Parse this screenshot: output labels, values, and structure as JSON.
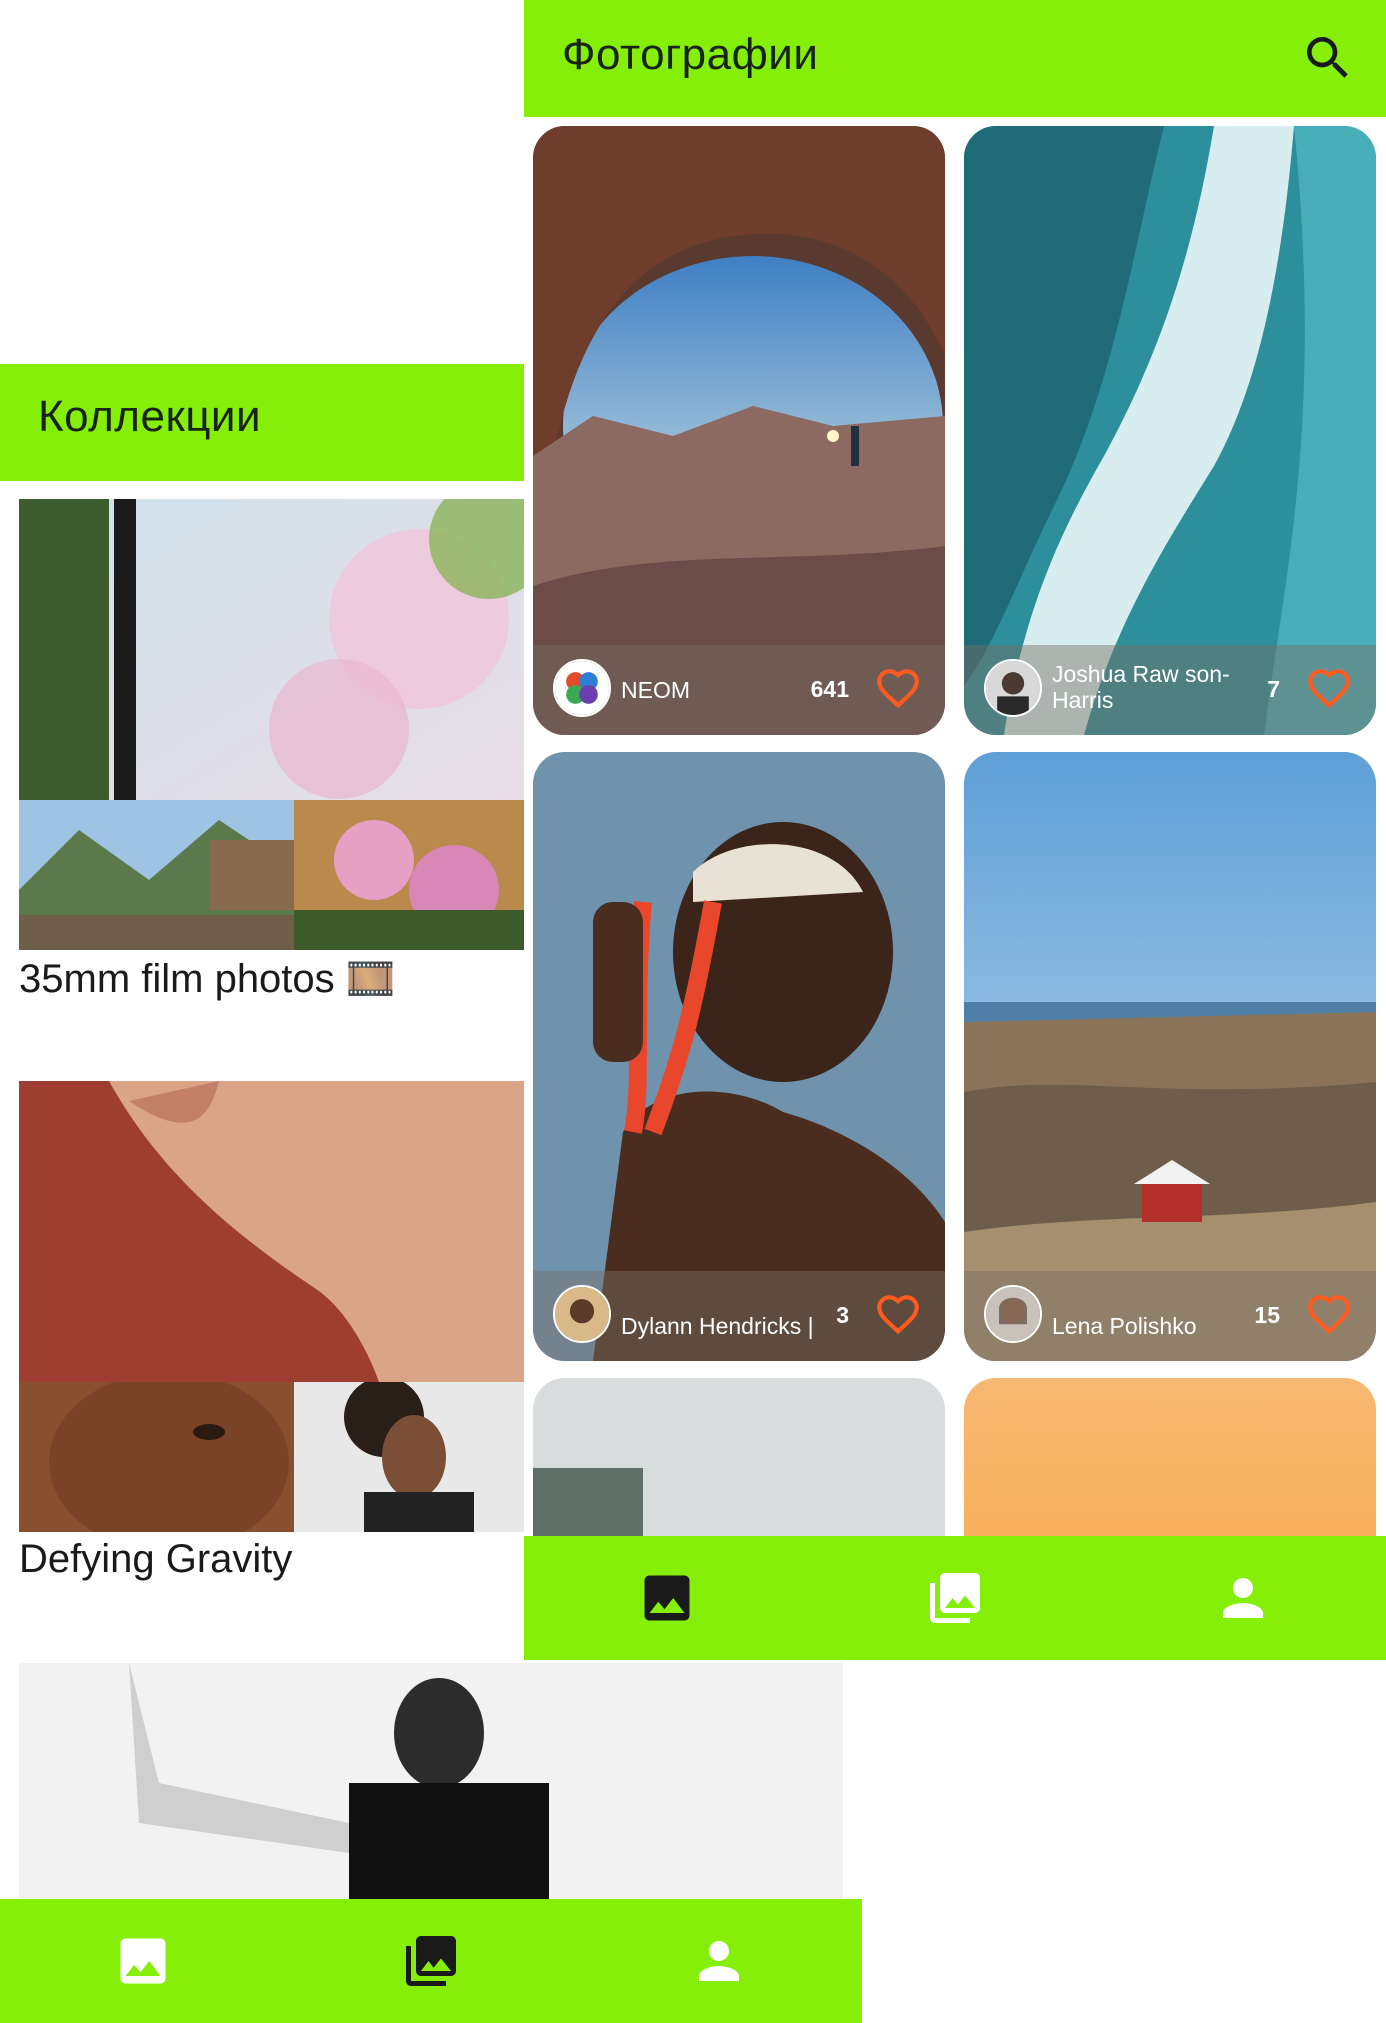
{
  "colors": {
    "accent": "#86ef0a",
    "heart": "#ff5a1f"
  },
  "collections_screen": {
    "title": "Коллекции",
    "collections": [
      {
        "title": "35mm film photos 🎞️"
      },
      {
        "title": "Defying Gravity"
      },
      {
        "title": ""
      }
    ],
    "bottom_nav": [
      {
        "icon": "photo-icon"
      },
      {
        "icon": "collections-icon"
      },
      {
        "icon": "profile-icon"
      }
    ]
  },
  "photos_screen": {
    "title": "Фотографии",
    "search_icon": "search-icon",
    "cards": [
      {
        "author": "NEOM",
        "likes": "641"
      },
      {
        "author": "Joshua Raw son-Harris",
        "likes": "7"
      },
      {
        "author": "Dylann Hendricks |",
        "likes": "3"
      },
      {
        "author": "Lena Polishko",
        "likes": "15"
      }
    ],
    "bottom_nav": [
      {
        "icon": "photo-icon"
      },
      {
        "icon": "collections-icon"
      },
      {
        "icon": "profile-icon"
      }
    ]
  }
}
